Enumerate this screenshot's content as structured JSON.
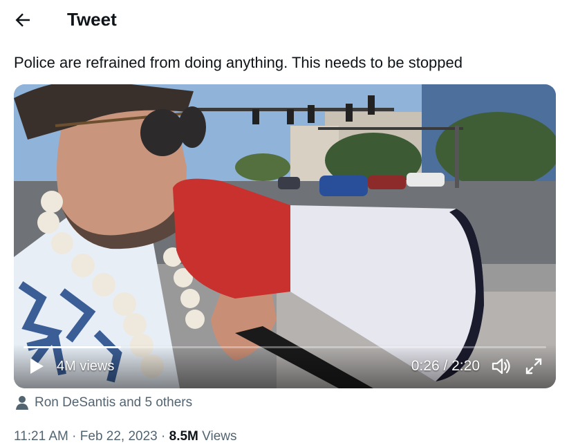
{
  "header": {
    "title": "Tweet"
  },
  "tweet": {
    "text": "Police are refrained from doing anything. This needs to be stopped"
  },
  "video": {
    "views": "4M views",
    "time": "0:26 / 2:20",
    "progress": 0.186
  },
  "tagged": {
    "text": "Ron DeSantis and 5 others"
  },
  "meta": {
    "time": "11:21 AM",
    "sep1": " · ",
    "date": "Feb 22, 2023",
    "sep2": " · ",
    "views_count": "8.5M",
    "views_label": " Views"
  },
  "icons": {
    "back": "arrow-left-icon",
    "play": "play-icon",
    "volume": "volume-icon",
    "fullscreen": "fullscreen-icon",
    "person": "person-icon"
  },
  "colors": {
    "text": "#0f1419",
    "secondary": "#536471",
    "megaphone_red": "#c8312d"
  }
}
